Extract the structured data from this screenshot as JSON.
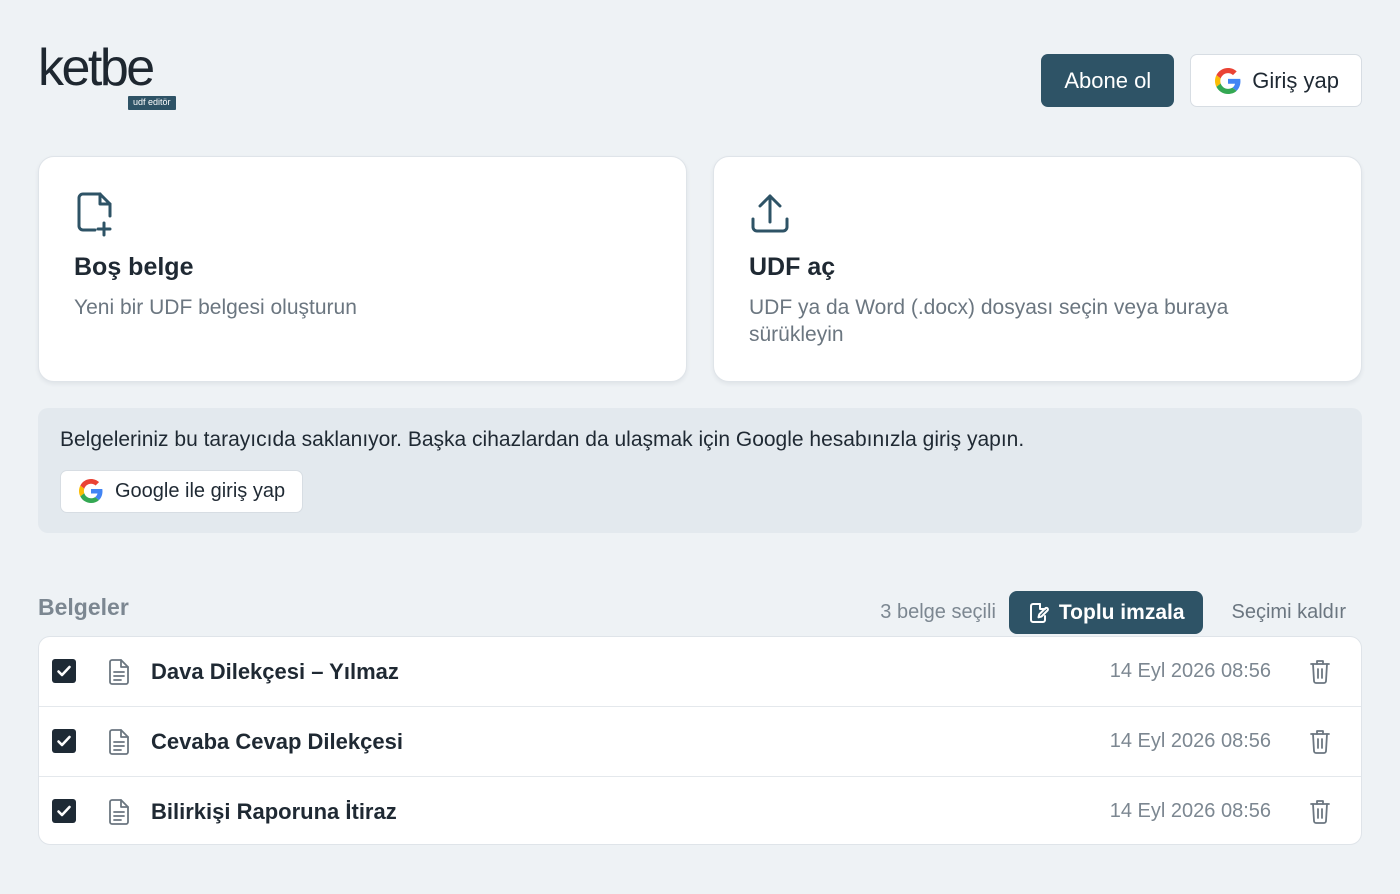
{
  "header": {
    "logo_text": "ketbe",
    "logo_badge": "udf editör",
    "subscribe_label": "Abone ol",
    "login_label": "Giriş yap"
  },
  "cards": [
    {
      "icon": "file-plus-icon",
      "title": "Boş belge",
      "description": "Yeni bir UDF belgesi oluşturun"
    },
    {
      "icon": "upload-icon",
      "title": "UDF aç",
      "description": "UDF ya da Word (.docx) dosyası seçin veya buraya sürükleyin"
    }
  ],
  "notice": {
    "text": "Belgeleriniz bu tarayıcıda saklanıyor. Başka cihazlardan da ulaşmak için Google hesabınızla giriş yapın.",
    "button_label": "Google ile giriş yap"
  },
  "documents": {
    "title": "Belgeler",
    "selection_count": "3 belge seçili",
    "bulk_sign_label": "Toplu imzala",
    "clear_selection_label": "Seçimi kaldır",
    "items": [
      {
        "name": "Dava Dilekçesi – Yılmaz",
        "date": "14 Eyl 2026 08:56",
        "checked": true
      },
      {
        "name": "Cevaba Cevap Dilekçesi",
        "date": "14 Eyl 2026 08:56",
        "checked": true
      },
      {
        "name": "Bilirkişi Raporuna İtiraz",
        "date": "14 Eyl 2026 08:56",
        "checked": true
      }
    ]
  },
  "colors": {
    "accent": "#2e5366",
    "background": "#eef2f5",
    "checkbox": "#1e2a35",
    "muted_text": "#7c8791"
  }
}
